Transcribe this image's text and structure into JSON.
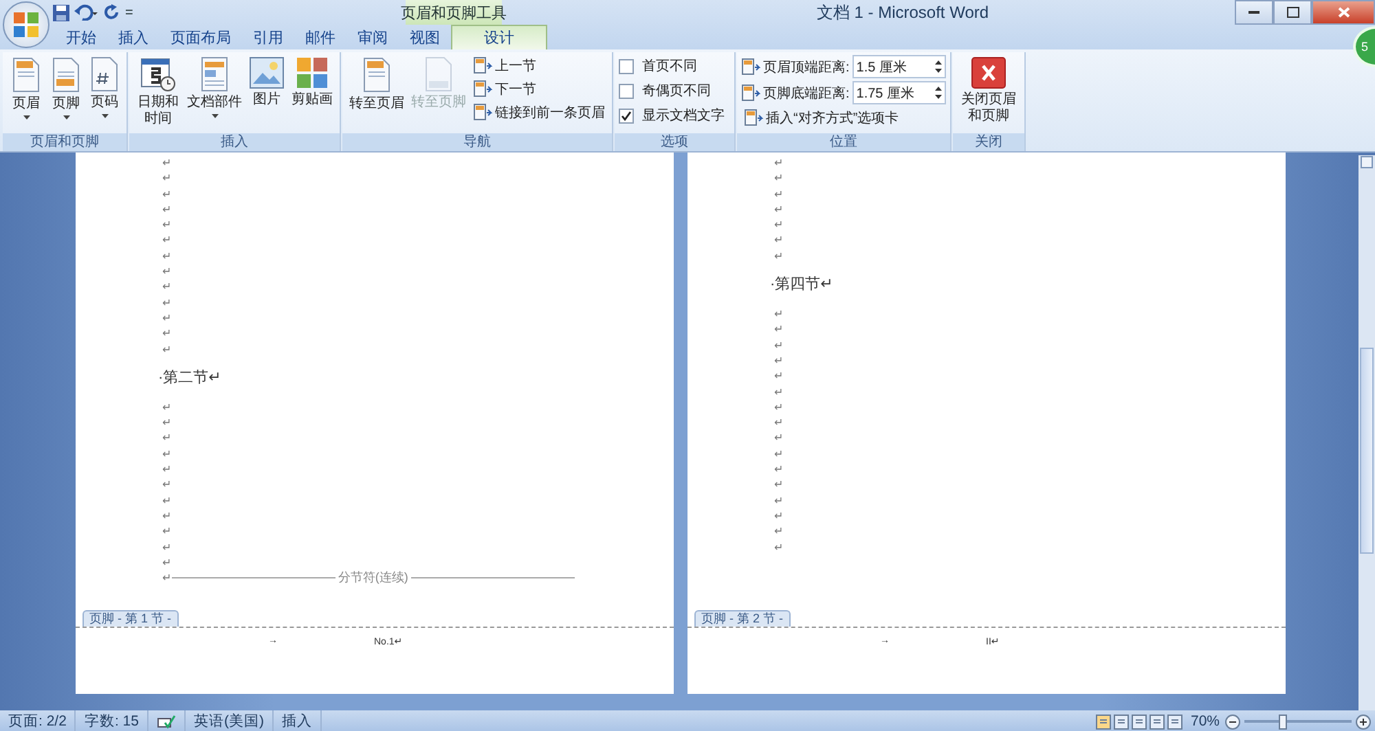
{
  "title_bar": {
    "customize": "=",
    "contextual_group": "页眉和页脚工具",
    "title": "文档 1 - Microsoft Word",
    "badge": "5"
  },
  "tabs": [
    {
      "label": "开始",
      "selected": false
    },
    {
      "label": "插入",
      "selected": false
    },
    {
      "label": "页面布局",
      "selected": false
    },
    {
      "label": "引用",
      "selected": false
    },
    {
      "label": "邮件",
      "selected": false
    },
    {
      "label": "审阅",
      "selected": false
    },
    {
      "label": "视图",
      "selected": false
    },
    {
      "label": "设计",
      "selected": true
    }
  ],
  "ribbon": {
    "groups": [
      {
        "label": "页眉和页脚",
        "items": [
          {
            "kind": "large",
            "label": "页眉",
            "dropdown": true,
            "disabled": false
          },
          {
            "kind": "large",
            "label": "页脚",
            "dropdown": true,
            "disabled": false
          },
          {
            "kind": "large",
            "label": "页码",
            "dropdown": true,
            "disabled": false
          }
        ]
      },
      {
        "label": "插入",
        "items": [
          {
            "kind": "large",
            "label": "日期和时间",
            "dropdown": false,
            "disabled": false
          },
          {
            "kind": "large",
            "label": "文档部件",
            "dropdown": true,
            "disabled": false
          },
          {
            "kind": "large",
            "label": "图片",
            "dropdown": false,
            "disabled": false
          },
          {
            "kind": "large",
            "label": "剪贴画",
            "dropdown": false,
            "disabled": false
          }
        ]
      },
      {
        "label": "导航",
        "items": [
          {
            "kind": "large",
            "label": "转至页眉",
            "dropdown": false,
            "disabled": false
          },
          {
            "kind": "large",
            "label": "转至页脚",
            "dropdown": false,
            "disabled": true
          },
          {
            "kind": "small",
            "label": "上一节"
          },
          {
            "kind": "small",
            "label": "下一节"
          },
          {
            "kind": "small",
            "label": "链接到前一条页眉"
          }
        ]
      },
      {
        "label": "选项",
        "items": [
          {
            "kind": "check",
            "label": "首页不同",
            "checked": false
          },
          {
            "kind": "check",
            "label": "奇偶页不同",
            "checked": false
          },
          {
            "kind": "check",
            "label": "显示文档文字",
            "checked": true
          }
        ]
      },
      {
        "label": "位置",
        "items": [
          {
            "kind": "spinner",
            "label": "页眉顶端距离:",
            "value": "1.5 厘米"
          },
          {
            "kind": "spinner",
            "label": "页脚底端距离:",
            "value": "1.75 厘米"
          },
          {
            "kind": "small",
            "label": "插入“对齐方式”选项卡"
          }
        ]
      },
      {
        "label": "关闭",
        "items": [
          {
            "kind": "large",
            "label": "关闭页眉和页脚",
            "dropdown": false,
            "disabled": false
          }
        ]
      }
    ]
  },
  "pages": [
    {
      "lines": [
        {
          "kind": "mark",
          "text": "↵"
        },
        {
          "kind": "mark",
          "text": "↵"
        },
        {
          "kind": "mark",
          "text": "↵"
        },
        {
          "kind": "mark",
          "text": "↵"
        },
        {
          "kind": "mark",
          "text": "↵"
        },
        {
          "kind": "mark",
          "text": "↵"
        },
        {
          "kind": "mark",
          "text": "↵"
        },
        {
          "kind": "mark",
          "text": "↵"
        },
        {
          "kind": "mark",
          "text": "↵"
        },
        {
          "kind": "mark",
          "text": "↵"
        },
        {
          "kind": "mark",
          "text": "↵"
        },
        {
          "kind": "mark",
          "text": "↵"
        },
        {
          "kind": "mark",
          "text": "↵"
        },
        {
          "kind": "heading",
          "text": "·第二节↵"
        },
        {
          "kind": "mark",
          "text": "↵"
        },
        {
          "kind": "mark",
          "text": "↵"
        },
        {
          "kind": "mark",
          "text": "↵"
        },
        {
          "kind": "mark",
          "text": "↵"
        },
        {
          "kind": "mark",
          "text": "↵"
        },
        {
          "kind": "mark",
          "text": "↵"
        },
        {
          "kind": "mark",
          "text": "↵"
        },
        {
          "kind": "mark",
          "text": "↵"
        },
        {
          "kind": "mark",
          "text": "↵"
        },
        {
          "kind": "mark",
          "text": "↵"
        },
        {
          "kind": "mark",
          "text": "↵"
        },
        {
          "kind": "section_break",
          "mark": "↵",
          "text": "分节符(连续)"
        }
      ],
      "footer": {
        "tab": "页脚 - 第 1 节 -",
        "tab_mark": "→",
        "content": "No.1↵"
      }
    },
    {
      "lines": [
        {
          "kind": "mark",
          "text": "↵"
        },
        {
          "kind": "mark",
          "text": "↵"
        },
        {
          "kind": "mark",
          "text": "↵"
        },
        {
          "kind": "mark",
          "text": "↵"
        },
        {
          "kind": "mark",
          "text": "↵"
        },
        {
          "kind": "mark",
          "text": "↵"
        },
        {
          "kind": "mark",
          "text": "↵"
        },
        {
          "kind": "heading",
          "text": "·第四节↵"
        },
        {
          "kind": "mark",
          "text": "↵"
        },
        {
          "kind": "mark",
          "text": "↵"
        },
        {
          "kind": "mark",
          "text": "↵"
        },
        {
          "kind": "mark",
          "text": "↵"
        },
        {
          "kind": "mark",
          "text": "↵"
        },
        {
          "kind": "mark",
          "text": "↵"
        },
        {
          "kind": "mark",
          "text": "↵"
        },
        {
          "kind": "mark",
          "text": "↵"
        },
        {
          "kind": "mark",
          "text": "↵"
        },
        {
          "kind": "mark",
          "text": "↵"
        },
        {
          "kind": "mark",
          "text": "↵"
        },
        {
          "kind": "mark",
          "text": "↵"
        },
        {
          "kind": "mark",
          "text": "↵"
        },
        {
          "kind": "mark",
          "text": "↵"
        },
        {
          "kind": "mark",
          "text": "↵"
        },
        {
          "kind": "mark",
          "text": "↵"
        }
      ],
      "footer": {
        "tab": "页脚 - 第 2 节 -",
        "tab_mark": "→",
        "content": "II↵"
      }
    }
  ],
  "status_bar": {
    "page": "页面: 2/2",
    "words": "字数: 15",
    "language": "英语(美国)",
    "mode": "插入",
    "zoom": "70%",
    "zoom_level": {
      "level": 0.36
    }
  }
}
